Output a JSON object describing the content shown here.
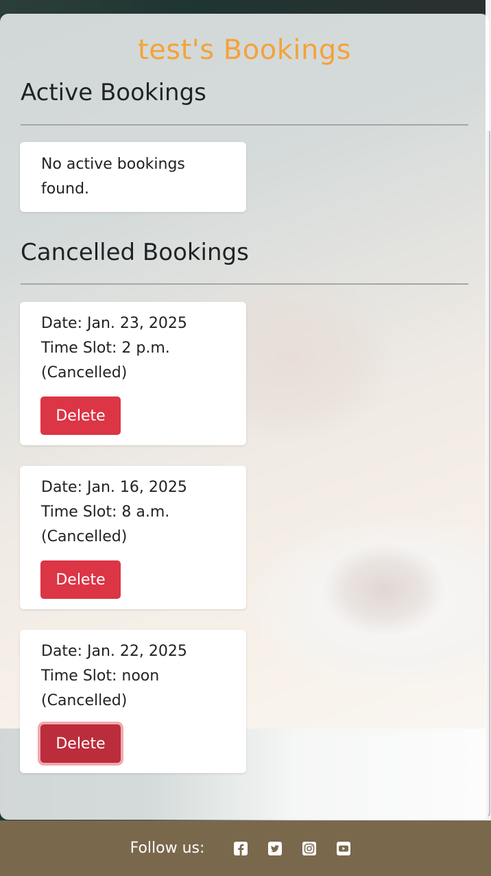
{
  "header": {
    "title": "test's Bookings"
  },
  "active": {
    "heading": "Active Bookings",
    "empty_message": "No active bookings found."
  },
  "cancelled": {
    "heading": "Cancelled Bookings",
    "bookings": [
      {
        "date": "Date: Jan. 23, 2025",
        "time": "Time Slot: 2 p.m.",
        "status": "(Cancelled)",
        "delete_label": "Delete"
      },
      {
        "date": "Date: Jan. 16, 2025",
        "time": "Time Slot: 8 a.m.",
        "status": "(Cancelled)",
        "delete_label": "Delete"
      },
      {
        "date": "Date: Jan. 22, 2025",
        "time": "Time Slot: noon",
        "status": "(Cancelled)",
        "delete_label": "Delete"
      }
    ]
  },
  "footer": {
    "follow_label": "Follow us:",
    "icons": [
      "facebook-icon",
      "twitter-icon",
      "instagram-icon",
      "youtube-icon"
    ]
  },
  "colors": {
    "title": "#f4a23a",
    "danger": "#dc3545",
    "footer_bg": "#7a684c"
  }
}
